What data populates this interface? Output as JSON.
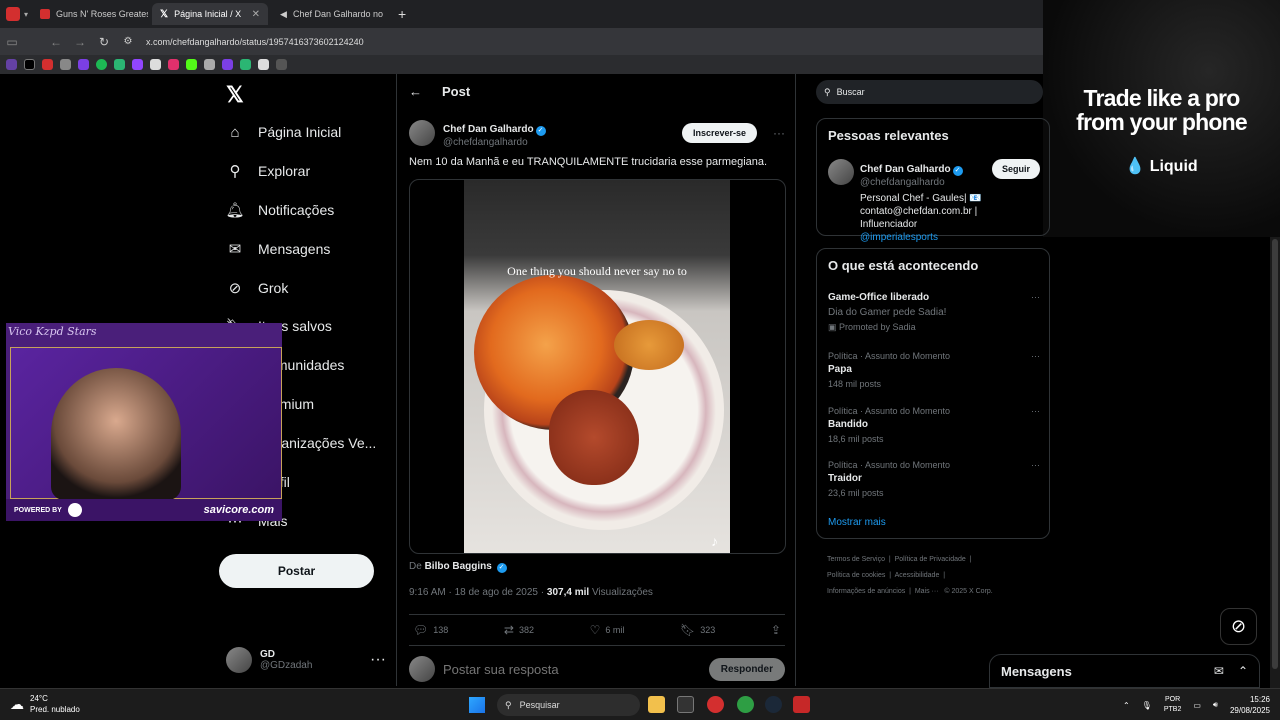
{
  "browser": {
    "tabs": [
      {
        "label": "Guns N' Roses Greates",
        "active": false,
        "favicon_color": "#d32f2f"
      },
      {
        "label": "Página Inicial / X",
        "active": true,
        "favicon_color": "#ffffff"
      },
      {
        "label": "Chef Dan Galhardo no",
        "active": false,
        "favicon_color": "#ffffff"
      }
    ],
    "url": "x.com/chefdangalhardo/status/1957416373602124240"
  },
  "ad": {
    "line1": "Trade like a pro",
    "line2": "from your phone",
    "brand": "Liquid"
  },
  "leftnav": {
    "items": [
      {
        "label": "Página Inicial",
        "icon": "home-icon"
      },
      {
        "label": "Explorar",
        "icon": "search-icon"
      },
      {
        "label": "Notificações",
        "icon": "bell-icon"
      },
      {
        "label": "Mensagens",
        "icon": "mail-icon"
      },
      {
        "label": "Grok",
        "icon": "grok-icon"
      },
      {
        "label": "Itens salvos",
        "icon": "bookmark-icon"
      },
      {
        "label": "Comunidades",
        "icon": "communities-icon"
      },
      {
        "label": "Premium",
        "icon": "premium-icon"
      },
      {
        "label": "Organizações Ve...",
        "icon": "organizations-icon"
      },
      {
        "label": "Perfil",
        "icon": "profile-icon"
      },
      {
        "label": "Mais",
        "icon": "more-circle-icon"
      }
    ],
    "post_button": "Postar",
    "account": {
      "name": "GD",
      "handle": "@GDzadah"
    }
  },
  "post": {
    "header": "Post",
    "author_name": "Chef Dan Galhardo",
    "author_handle": "@chefdangalhardo",
    "subscribe": "Inscrever-se",
    "text": "Nem 10 da Manhã e eu TRANQUILAMENTE trucidaria esse parmegiana.",
    "video_caption": "One thing you should never say no to",
    "from_prefix": "De",
    "from_name": "Bilbo Baggins",
    "time": "9:16 AM · 18 de ago de 2025 ·",
    "views_count": "307,4 mil",
    "views_label": "Visualizações",
    "stats": {
      "replies": "138",
      "reposts": "382",
      "likes": "6 mil",
      "bookmarks": "323"
    },
    "reply_placeholder": "Postar sua resposta",
    "reply_button": "Responder"
  },
  "right": {
    "search_placeholder": "Buscar",
    "relevant": {
      "title": "Pessoas relevantes",
      "name": "Chef Dan Galhardo",
      "handle": "@chefdangalhardo",
      "follow": "Seguir",
      "bio": "Personal Chef - Gaules| 📧 contato@chefdan.com.br | Influenciador",
      "bio_link": "@imperialesports"
    },
    "trending": {
      "title": "O que está acontecendo",
      "items": [
        {
          "category": "Game-Office liberado",
          "title": "Dia do Gamer pede Sadia!",
          "posts": "Promoted by Sadia"
        },
        {
          "category": "Política · Assunto do Momento",
          "title": "Papa",
          "posts": "148 mil posts"
        },
        {
          "category": "Política · Assunto do Momento",
          "title": "Bandido",
          "posts": "18,6 mil posts"
        },
        {
          "category": "Política · Assunto do Momento",
          "title": "Traidor",
          "posts": "23,6 mil posts"
        }
      ],
      "show_more": "Mostrar mais"
    },
    "footer": {
      "l1a": "Termos de Serviço",
      "l1b": "Política de Privacidade",
      "l2a": "Política de cookies",
      "l2b": "Acessibilidade",
      "l3a": "Informações de anúncios",
      "l3b": "Mais ···",
      "l3c": "© 2025 X Corp."
    }
  },
  "messages_drawer": {
    "title": "Mensagens"
  },
  "webcam": {
    "signature": "Vico Kzpd Stars",
    "powered": "POWERED BY",
    "sponsor": "savicore.com"
  },
  "taskbar": {
    "temp": "24°C",
    "weather": "Pred. nublado",
    "search": "Pesquisar",
    "lang1": "POR",
    "lang2": "PTB2",
    "time": "15:26",
    "date": "29/08/2025"
  }
}
